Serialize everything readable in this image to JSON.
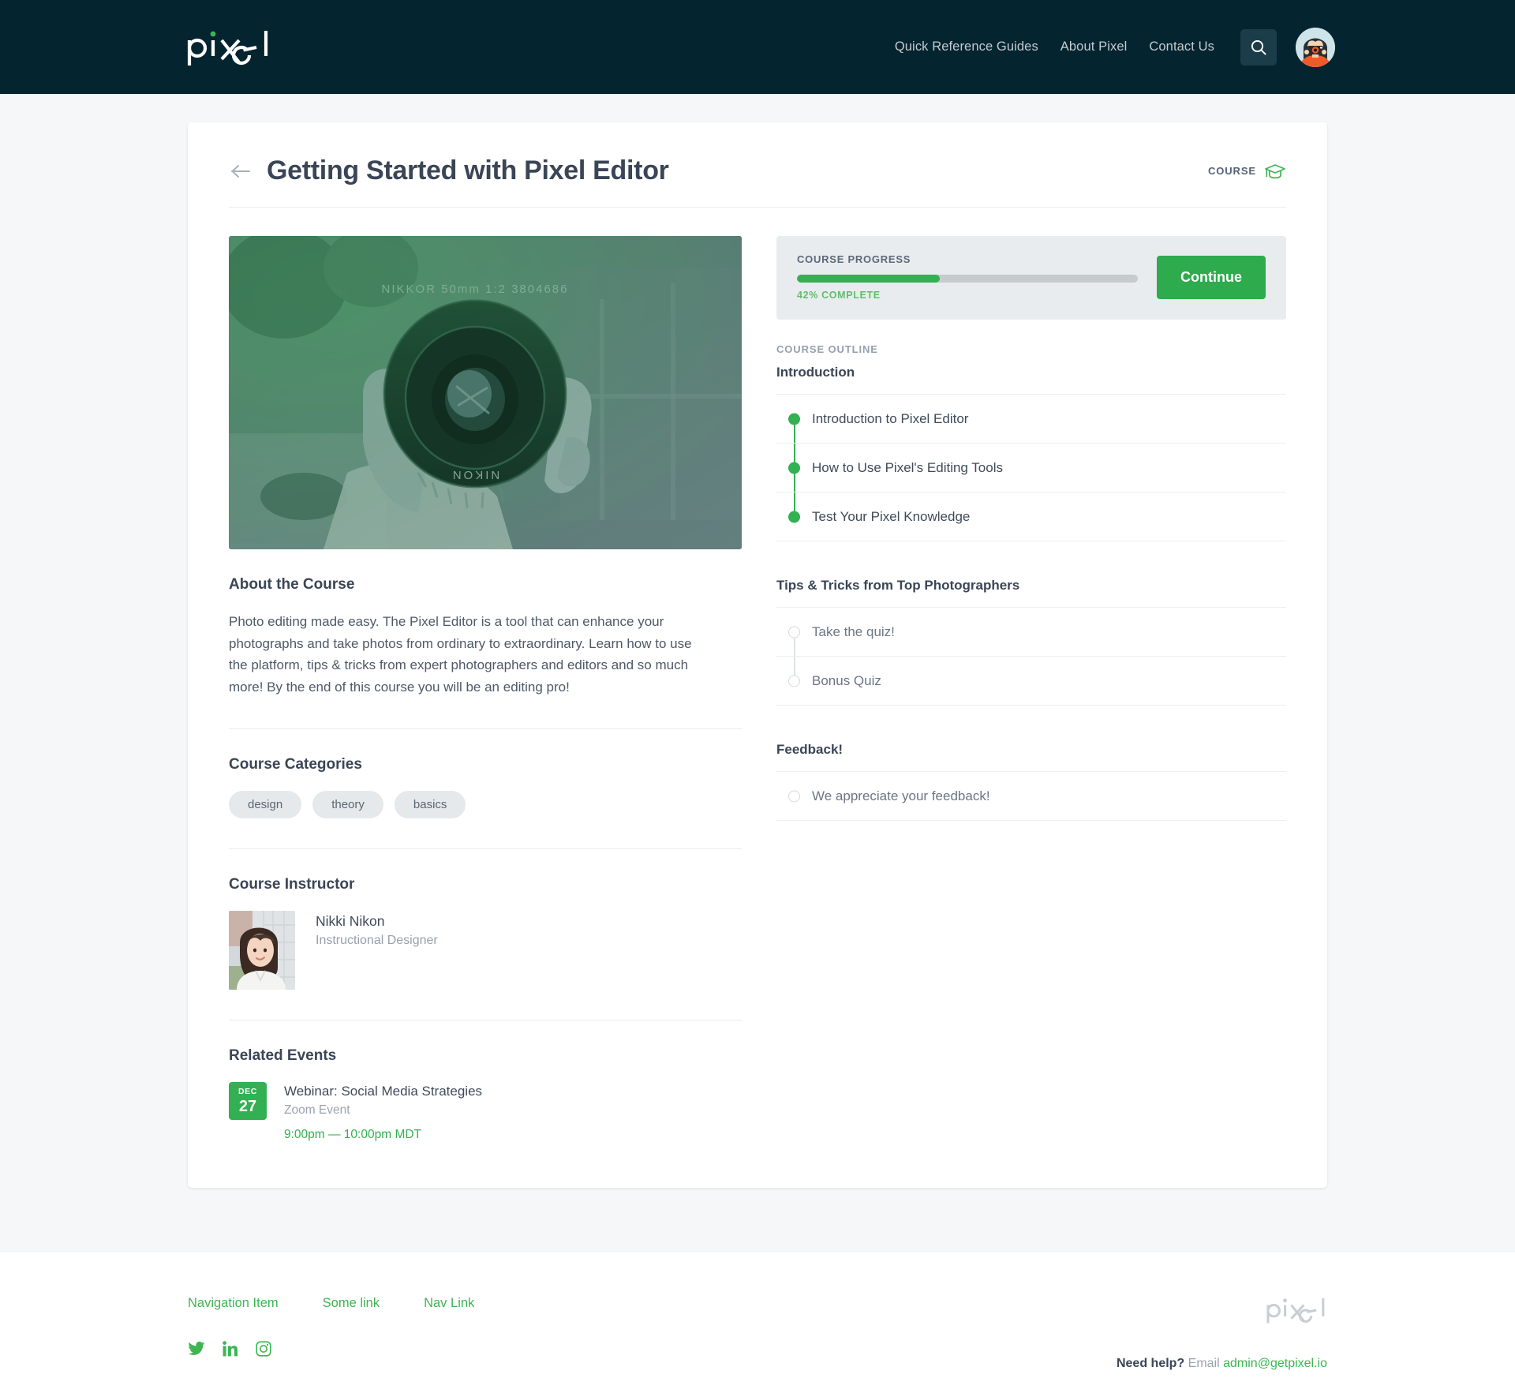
{
  "header": {
    "logo_text": "pixel",
    "nav": [
      {
        "label": "Quick Reference Guides"
      },
      {
        "label": "About Pixel"
      },
      {
        "label": "Contact Us"
      }
    ],
    "search_icon": "search-icon",
    "avatar_alt": "user-avatar"
  },
  "page": {
    "back_icon": "arrow-left-icon",
    "title": "Getting Started with Pixel Editor",
    "badge_label": "COURSE",
    "badge_icon": "graduation-cap-icon"
  },
  "hero": {
    "alt": "hand holding a Nikon 50mm camera lens",
    "lens_text_top": "NIKKOR  50mm   1:2    3804686",
    "lens_text_bottom": "NIKON"
  },
  "about": {
    "title": "About the Course",
    "body": "Photo editing made easy. The Pixel Editor is a tool that can enhance your photographs and take photos from ordinary to extraordinary.  Learn how to use the platform, tips & tricks from expert photographers and editors and so much more! By the end of this course you will be an editing pro!"
  },
  "categories": {
    "title": "Course Categories",
    "tags": [
      "design",
      "theory",
      "basics"
    ]
  },
  "instructor": {
    "title": "Course Instructor",
    "name": "Nikki Nikon",
    "role": "Instructional Designer",
    "photo_alt": "instructor-portrait"
  },
  "events": {
    "title": "Related Events",
    "items": [
      {
        "month": "DEC",
        "day": "27",
        "title": "Webinar: Social Media Strategies",
        "subtitle": "Zoom Event",
        "time": "9:00pm — 10:00pm MDT"
      }
    ]
  },
  "progress": {
    "label": "COURSE PROGRESS",
    "percent": 42,
    "percent_text": "42% COMPLETE",
    "continue_label": "Continue",
    "fill_color": "#32b052",
    "track_color": "#c6cbce"
  },
  "outline": {
    "label": "COURSE OUTLINE",
    "groups": [
      {
        "title": "Introduction",
        "items": [
          {
            "label": "Introduction to Pixel Editor",
            "status": "done"
          },
          {
            "label": "How to Use Pixel's Editing Tools",
            "status": "done"
          },
          {
            "label": "Test Your Pixel Knowledge",
            "status": "done"
          }
        ]
      },
      {
        "title": "Tips & Tricks from Top Photographers",
        "items": [
          {
            "label": "Take the quiz!",
            "status": "todo"
          },
          {
            "label": "Bonus Quiz",
            "status": "todo"
          }
        ]
      },
      {
        "title": "Feedback!",
        "items": [
          {
            "label": "We appreciate your feedback!",
            "status": "todo"
          }
        ]
      }
    ]
  },
  "footer": {
    "nav": [
      {
        "label": "Navigation Item"
      },
      {
        "label": "Some link"
      },
      {
        "label": "Nav Link"
      }
    ],
    "socials": [
      {
        "name": "twitter-icon"
      },
      {
        "name": "linkedin-icon"
      },
      {
        "name": "instagram-icon"
      }
    ],
    "logo_text": "pixel",
    "help_prefix": "Need help?",
    "help_mid": "Email",
    "help_email": "admin@getpixel.io"
  },
  "colors": {
    "header_bg": "#04242f",
    "accent_green": "#32b052",
    "page_bg": "#f5f7f8",
    "text_dark": "#3a4556"
  }
}
